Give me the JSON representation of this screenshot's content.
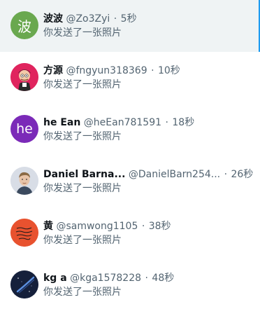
{
  "separator": "·",
  "conversations": [
    {
      "name": "波波",
      "handle": "@Zo3Zyi",
      "time": "5秒",
      "preview": "你发送了一张照片",
      "avatar_text": "波",
      "avatar_color": "#6aa84f",
      "selected": true
    },
    {
      "name": "方源",
      "handle": "@fngyun318369",
      "time": "10秒",
      "preview": "你发送了一张照片",
      "avatar_icon": "cartoon-character-avatar",
      "avatar_color": "#e0245e"
    },
    {
      "name": "he Ean",
      "handle": "@heEan781591",
      "time": "18秒",
      "preview": "你发送了一张照片",
      "avatar_text": "he",
      "avatar_color": "#7b2ab8"
    },
    {
      "name": "Daniel Barna...",
      "handle": "@DanielBarn254...",
      "time": "26秒",
      "preview": "你发送了一张照片",
      "avatar_icon": "person-photo-avatar",
      "avatar_color": "#d8dde6"
    },
    {
      "name": "黄",
      "handle": "@samwong1105",
      "time": "38秒",
      "preview": "你发送了一张照片",
      "avatar_icon": "handwritten-note-avatar",
      "avatar_color": "#e8522f"
    },
    {
      "name": "kg a",
      "handle": "@kga1578228",
      "time": "48秒",
      "preview": "你发送了一张照片",
      "avatar_icon": "night-sky-avatar",
      "avatar_color": "#15203b"
    }
  ]
}
